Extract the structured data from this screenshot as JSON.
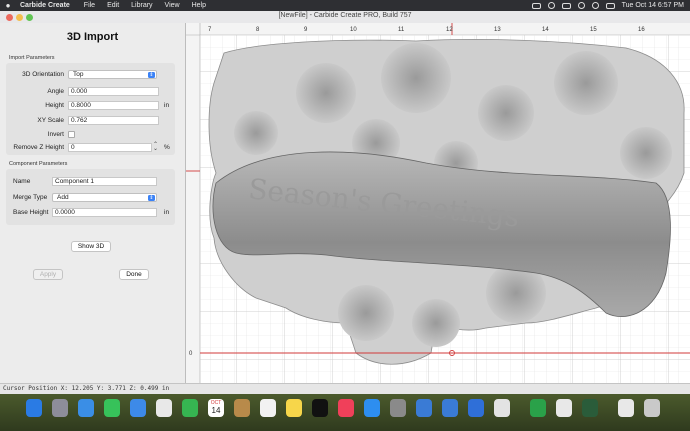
{
  "menubar": {
    "app_name": "Carbide Create",
    "menus": [
      "File",
      "Edit",
      "Library",
      "View",
      "Help"
    ],
    "datetime": "Tue Oct 14  6:57 PM"
  },
  "window": {
    "title": "[NewFile] - Carbide Create PRO, Build 757"
  },
  "panel": {
    "title": "3D Import",
    "import_section": "Import Parameters",
    "orientation_label": "3D Orientation",
    "orientation_value": "Top",
    "angle_label": "Angle",
    "angle_value": "0.000",
    "height_label": "Height",
    "height_value": "0.8000",
    "height_unit": "in",
    "xyscale_label": "XY Scale",
    "xyscale_value": "0.762",
    "invert_label": "Invert",
    "removez_label": "Remove Z Height",
    "removez_value": "0",
    "removez_unit": "%",
    "component_section": "Component Parameters",
    "name_label": "Name",
    "name_value": "Component 1",
    "merge_label": "Merge Type",
    "merge_value": "Add",
    "baseheight_label": "Base Height",
    "baseheight_value": "0.0000",
    "baseheight_unit": "in",
    "show3d_label": "Show 3D",
    "apply_label": "Apply",
    "done_label": "Done"
  },
  "canvas": {
    "ruler_ticks": [
      "7",
      "8",
      "9",
      "10",
      "11",
      "12",
      "13",
      "14",
      "15",
      "16"
    ],
    "left_ruler_zero": "0",
    "relief_text": "Season's Greetings"
  },
  "status": {
    "text": "Cursor Position X: 12.205 Y: 3.771 Z: 0.499 in"
  },
  "dock": {
    "calendar_month": "OCT",
    "calendar_day": "14"
  },
  "colors": {
    "accent": "#3b82f6",
    "guide_red": "#d23a3a"
  }
}
